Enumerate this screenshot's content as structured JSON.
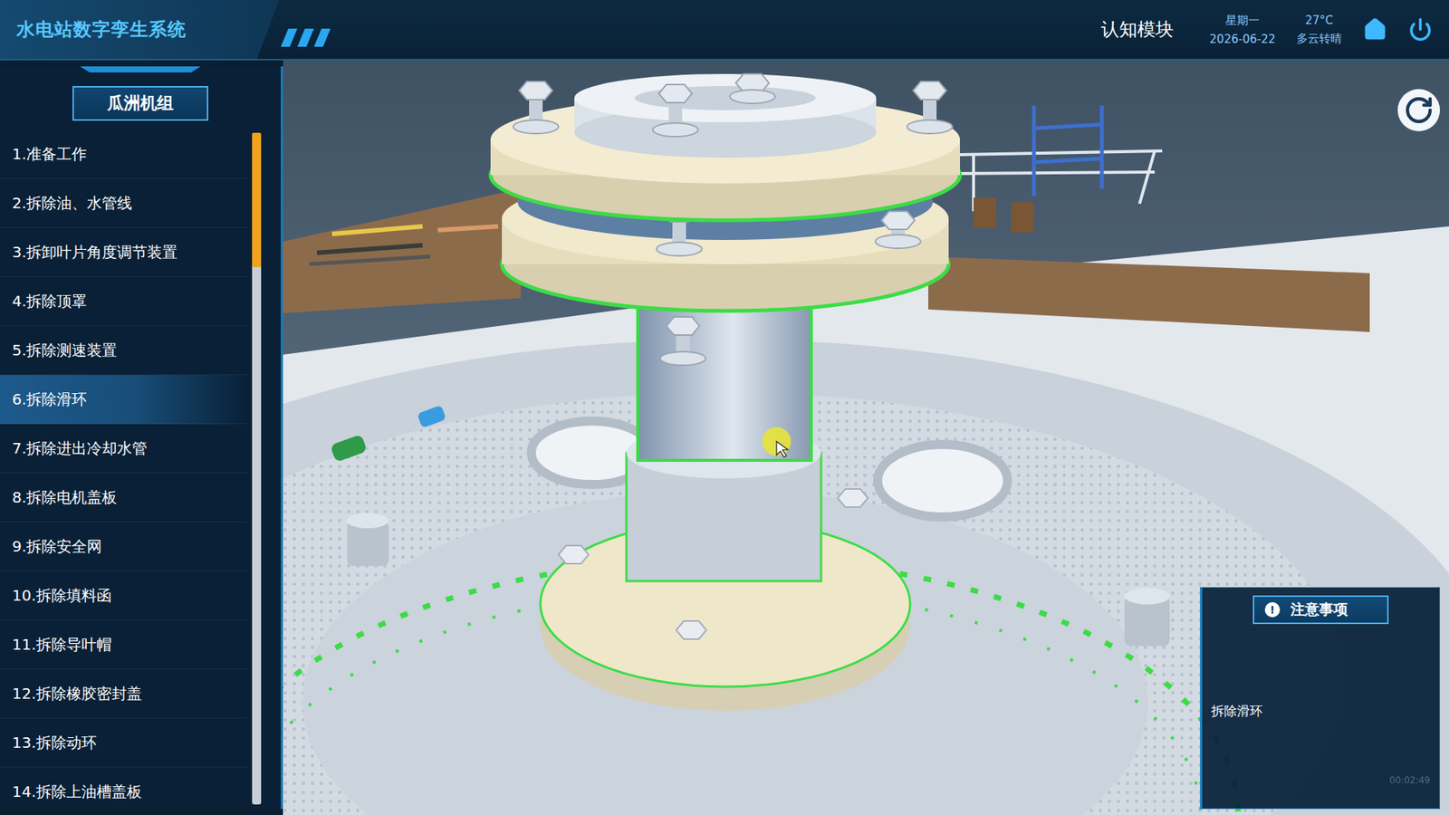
{
  "header": {
    "title": "水电站数字孪生系统",
    "module": "认知模块",
    "weekday": "星期一",
    "date": "2026-06-22",
    "temperature": "27°C",
    "weather": "多云转晴"
  },
  "sidebar": {
    "title": "瓜洲机组",
    "items": [
      {
        "label": "1.准备工作",
        "selected": false
      },
      {
        "label": "2.拆除油、水管线",
        "selected": false
      },
      {
        "label": "3.拆卸叶片角度调节装置",
        "selected": false
      },
      {
        "label": "4.拆除顶罩",
        "selected": false
      },
      {
        "label": "5.拆除测速装置",
        "selected": false
      },
      {
        "label": "6.拆除滑环",
        "selected": true
      },
      {
        "label": "7.拆除进出冷却水管",
        "selected": false
      },
      {
        "label": "8.拆除电机盖板",
        "selected": false
      },
      {
        "label": "9.拆除安全网",
        "selected": false
      },
      {
        "label": "10.拆除填料函",
        "selected": false
      },
      {
        "label": "11.拆除导叶帽",
        "selected": false
      },
      {
        "label": "12.拆除橡胶密封盖",
        "selected": false
      },
      {
        "label": "13.拆除动环",
        "selected": false
      },
      {
        "label": "14.拆除上油槽盖板",
        "selected": false
      }
    ],
    "scroll": {
      "level": 0.2
    }
  },
  "notes": {
    "icon": "!",
    "title": "注意事项",
    "content": "拆除滑环",
    "time": "00:02:49"
  }
}
